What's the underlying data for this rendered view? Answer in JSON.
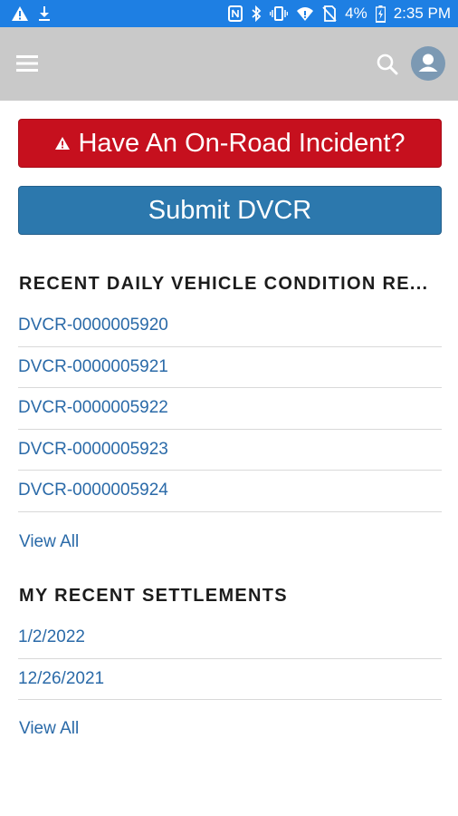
{
  "status_bar": {
    "battery": "4%",
    "time": "2:35 PM",
    "icons": [
      "warning-icon",
      "download-icon",
      "nfc-icon",
      "bluetooth-icon",
      "vibrate-icon",
      "wifi-icon",
      "no-sim-icon",
      "battery-charging-icon"
    ]
  },
  "app_bar": {
    "icons": [
      "hamburger-menu-icon",
      "search-icon",
      "avatar-icon"
    ]
  },
  "actions": {
    "incident_label": "Have An On-Road Incident?",
    "dvcr_label": "Submit DVCR"
  },
  "dvcr_section": {
    "title": "RECENT DAILY VEHICLE CONDITION RE...",
    "items": [
      "DVCR-0000005920",
      "DVCR-0000005921",
      "DVCR-0000005922",
      "DVCR-0000005923",
      "DVCR-0000005924"
    ],
    "view_all": "View All"
  },
  "settlements_section": {
    "title": "MY RECENT SETTLEMENTS",
    "items": [
      "1/2/2022",
      "12/26/2021"
    ],
    "view_all": "View All"
  },
  "colors": {
    "status_bar": "#1e7fe3",
    "app_bar": "#c9c9c9",
    "incident_button": "#c6101e",
    "dvcr_button": "#2c78ad",
    "link": "#2a6aa8"
  }
}
